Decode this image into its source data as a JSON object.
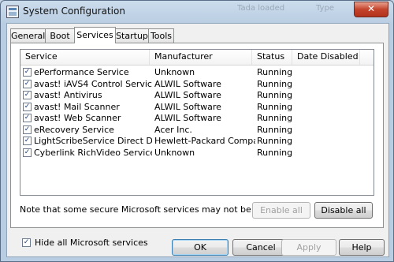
{
  "window": {
    "title": "System Configuration",
    "background_text": [
      "Tada loaded",
      "Type"
    ],
    "close_glyph": "✕"
  },
  "tabs": [
    {
      "label": "General"
    },
    {
      "label": "Boot"
    },
    {
      "label": "Services"
    },
    {
      "label": "Startup"
    },
    {
      "label": "Tools"
    }
  ],
  "active_tab": "Services",
  "services": {
    "columns": [
      "Service",
      "Manufacturer",
      "Status",
      "Date Disabled"
    ],
    "rows": [
      {
        "checked": true,
        "service": "ePerformance Service",
        "manufacturer": "Unknown",
        "status": "Running",
        "date_disabled": ""
      },
      {
        "checked": true,
        "service": "avast! iAVS4 Control Service",
        "manufacturer": "ALWIL Software",
        "status": "Running",
        "date_disabled": ""
      },
      {
        "checked": true,
        "service": "avast! Antivirus",
        "manufacturer": "ALWIL Software",
        "status": "Running",
        "date_disabled": ""
      },
      {
        "checked": true,
        "service": "avast! Mail Scanner",
        "manufacturer": "ALWIL Software",
        "status": "Running",
        "date_disabled": ""
      },
      {
        "checked": true,
        "service": "avast! Web Scanner",
        "manufacturer": "ALWIL Software",
        "status": "Running",
        "date_disabled": ""
      },
      {
        "checked": true,
        "service": "eRecovery Service",
        "manufacturer": "Acer Inc.",
        "status": "Running",
        "date_disabled": ""
      },
      {
        "checked": true,
        "service": "LightScribeService Direct Disc La...",
        "manufacturer": "Hewlett-Packard Company",
        "status": "Running",
        "date_disabled": ""
      },
      {
        "checked": true,
        "service": "Cyberlink RichVideo Service(CRVS)",
        "manufacturer": "Unknown",
        "status": "Running",
        "date_disabled": ""
      }
    ]
  },
  "note": "Note that some secure Microsoft services may not be disabled.",
  "enable_all": {
    "label": "Enable all",
    "enabled": false
  },
  "disable_all": {
    "label": "Disable all",
    "enabled": true
  },
  "hide_ms": {
    "label": "Hide all Microsoft services",
    "checked": true
  },
  "footer": {
    "ok": "OK",
    "cancel": "Cancel",
    "apply": "Apply",
    "help": "Help"
  },
  "icons": {
    "app": "system-config-icon",
    "checkmark": "✓"
  },
  "colors": {
    "frame": "#b9cde2",
    "close": "#c4432b"
  }
}
